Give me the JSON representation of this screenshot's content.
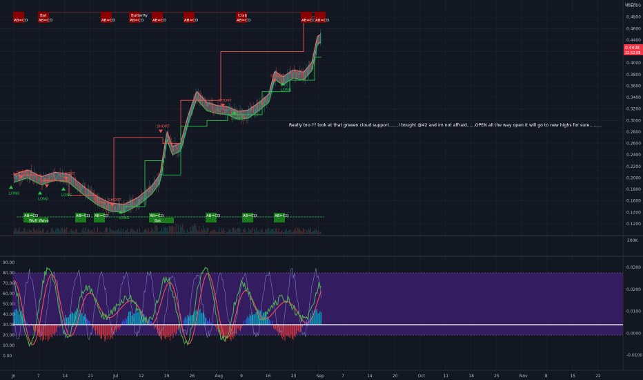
{
  "price_axis": {
    "currency": "USDT",
    "ticks": [
      "0.5000",
      "0.4800",
      "0.4600",
      "0.4400",
      "0.4200",
      "0.4000",
      "0.3800",
      "0.3600",
      "0.3400",
      "0.3200",
      "0.3000",
      "0.2800",
      "0.2600",
      "0.2400",
      "0.2200",
      "0.2000",
      "0.1800",
      "0.1600",
      "0.1400",
      "0.1200"
    ],
    "tick_values": [
      0.5,
      0.48,
      0.46,
      0.44,
      0.42,
      0.4,
      0.38,
      0.36,
      0.34,
      0.32,
      0.3,
      0.28,
      0.26,
      0.24,
      0.22,
      0.2,
      0.18,
      0.16,
      0.14,
      0.12
    ],
    "last_price": "0.4408",
    "countdown": "22:52:08",
    "volume_label": "200K"
  },
  "osc_left_axis": [
    "90.00",
    "80.00",
    "70.00",
    "60.00",
    "50.00",
    "40.00",
    "30.00",
    "20.00",
    "10.00",
    "0.00"
  ],
  "osc_right_axis": [
    "0.0300",
    "0.0200",
    "0.0100",
    "0.0000",
    "-0.0100"
  ],
  "time_axis": [
    "Jn",
    "7",
    "14",
    "21",
    "Jul",
    "12",
    "19",
    "26",
    "Aug",
    "9",
    "16",
    "23",
    "Sep",
    "7",
    "14",
    "20",
    "Oct",
    "11",
    "18",
    "25",
    "Nov",
    "8",
    "15",
    "22"
  ],
  "patterns_top": [
    {
      "top": "",
      "bottom": "AB=CD"
    },
    {
      "top": "Bat",
      "bottom": "AB=CD"
    },
    {
      "top": "",
      "bottom": "AB=CD"
    },
    {
      "top": "Butterfly",
      "bottom": "AB=CD"
    },
    {
      "top": "",
      "bottom": "AB=CD"
    },
    {
      "top": "",
      "bottom": "AB=CD"
    },
    {
      "top": "Crab",
      "bottom": "AB=CD"
    },
    {
      "top": "",
      "bottom": "AB=CD"
    },
    {
      "top": "",
      "bottom": "AB=CD"
    }
  ],
  "patterns_bottom": [
    {
      "top": "AB=CD",
      "bottom": "Wolf Wave"
    },
    {
      "top": "AB=CD",
      "bottom": ""
    },
    {
      "top": "AB=CD",
      "bottom": ""
    },
    {
      "top": "AB=CD",
      "bottom": "Bat"
    },
    {
      "top": "AB=CD",
      "bottom": ""
    },
    {
      "top": "AB=CD",
      "bottom": ""
    },
    {
      "top": "AB=CD",
      "bottom": ""
    }
  ],
  "signals": [
    {
      "label": "SHORT",
      "kind": "short"
    },
    {
      "label": "SHORT",
      "kind": "short"
    },
    {
      "label": "SHORT",
      "kind": "short"
    },
    {
      "label": "SHORT",
      "kind": "short"
    },
    {
      "label": "SHORT",
      "kind": "short"
    },
    {
      "label": "SHORT",
      "kind": "short"
    },
    {
      "label": "SHORT",
      "kind": "short"
    },
    {
      "label": "LONG",
      "kind": "long"
    },
    {
      "label": "LONG",
      "kind": "long"
    },
    {
      "label": "LONG",
      "kind": "long"
    },
    {
      "label": "LONG",
      "kind": "long"
    },
    {
      "label": "LONG",
      "kind": "long"
    },
    {
      "label": "LONG",
      "kind": "long"
    }
  ],
  "annotation": "Really bro ?? look at that greeen cloud support.......i bought @42 and im not affraid......OPEN all the way open it will go to new highs for sure.........",
  "colors": {
    "background": "#131722",
    "bull": "#26a69a",
    "bear": "#ef5350",
    "pattern_red": "#8b0000",
    "pattern_green": "#1b7a1b",
    "osc_fill": "#3b1d6b",
    "price_tag": "#f23645"
  },
  "chart_data": {
    "type": "line",
    "series": [],
    "osc_band": [
      20,
      80
    ],
    "osc_midline": 30
  }
}
